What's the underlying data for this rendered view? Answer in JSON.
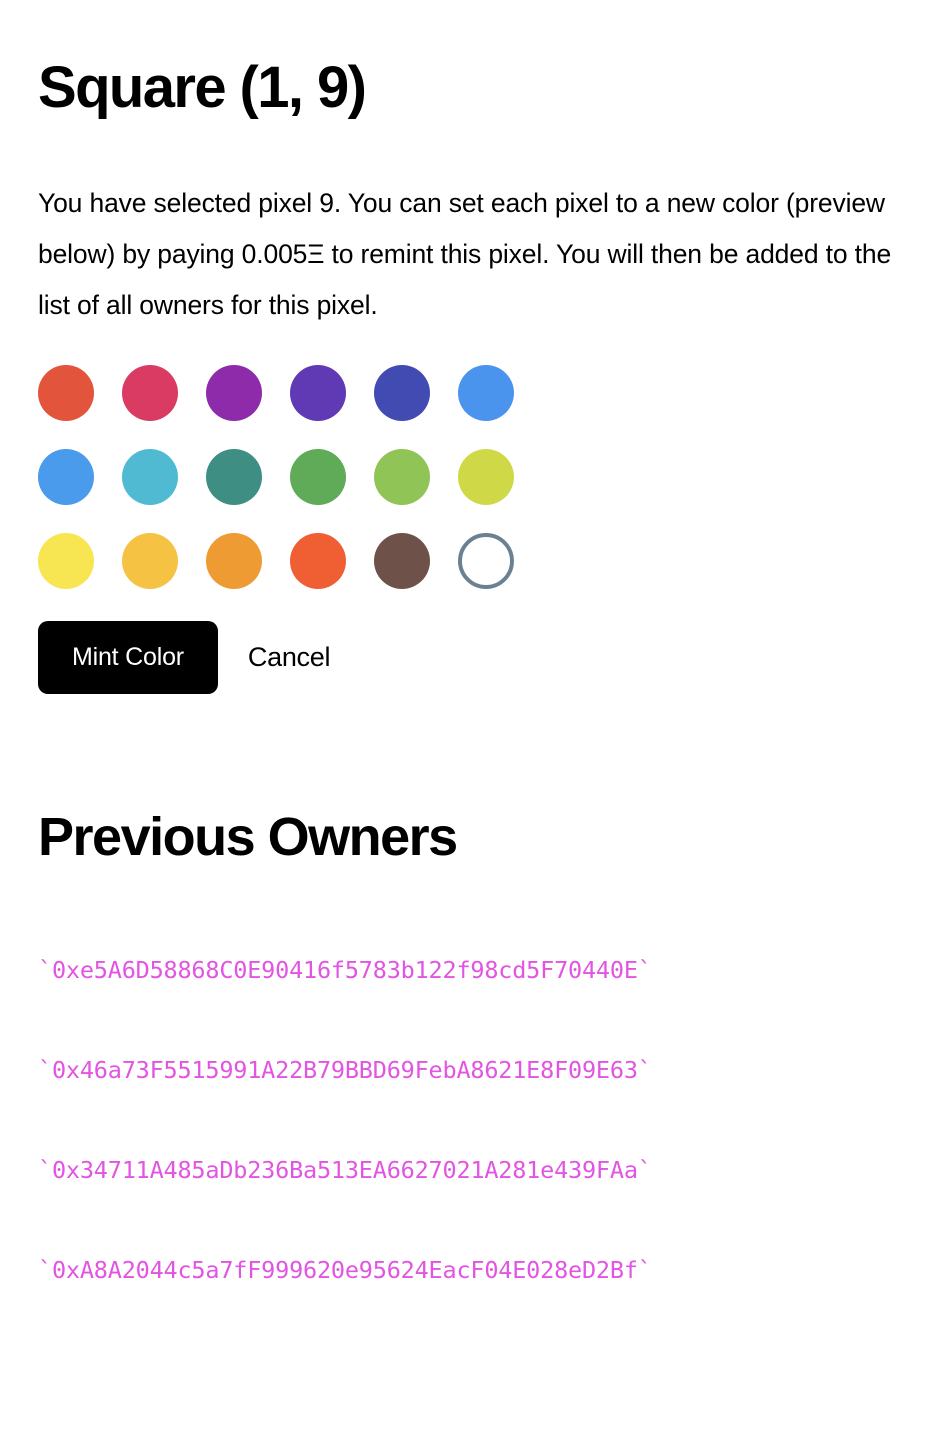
{
  "page": {
    "title": "Square (1, 9)",
    "description": "You have selected pixel 9. You can set each pixel to a new color (preview below) by paying 0.005Ξ to remint this pixel. You will then be added to the list of all owners for this pixel."
  },
  "palette": {
    "rows": [
      [
        {
          "name": "swatch-red",
          "color": "#E2543C"
        },
        {
          "name": "swatch-crimson",
          "color": "#D93B63"
        },
        {
          "name": "swatch-purple",
          "color": "#8E2BAB"
        },
        {
          "name": "swatch-violet",
          "color": "#6039B4"
        },
        {
          "name": "swatch-indigo",
          "color": "#424BB2"
        },
        {
          "name": "swatch-blue",
          "color": "#4A94EE"
        }
      ],
      [
        {
          "name": "swatch-sky-blue",
          "color": "#4A9BEB"
        },
        {
          "name": "swatch-cyan",
          "color": "#51BAD3"
        },
        {
          "name": "swatch-teal",
          "color": "#3E8E84"
        },
        {
          "name": "swatch-green",
          "color": "#5FAB58"
        },
        {
          "name": "swatch-light-green",
          "color": "#91C457"
        },
        {
          "name": "swatch-lime",
          "color": "#CFD948"
        }
      ],
      [
        {
          "name": "swatch-yellow",
          "color": "#F8E552"
        },
        {
          "name": "swatch-gold",
          "color": "#F5C243"
        },
        {
          "name": "swatch-orange",
          "color": "#EE9B33"
        },
        {
          "name": "swatch-deep-orange",
          "color": "#EF5F33"
        },
        {
          "name": "swatch-brown",
          "color": "#6E5249"
        },
        {
          "name": "swatch-white-outline",
          "color": "#FFFFFF",
          "ring": "#6B8191"
        }
      ]
    ]
  },
  "actions": {
    "mint_label": "Mint Color",
    "cancel_label": "Cancel"
  },
  "owners": {
    "heading": "Previous Owners",
    "items": [
      "`0xe5A6D58868C0E90416f5783b122f98cd5F70440E`",
      "`0x46a73F5515991A22B79BBD69FebA8621E8F09E63`",
      "`0x34711A485aDb236Ba513EA6627021A281e439FAa`",
      "`0xA8A2044c5a7fF999620e95624EacF04E028eD2Bf`"
    ]
  }
}
